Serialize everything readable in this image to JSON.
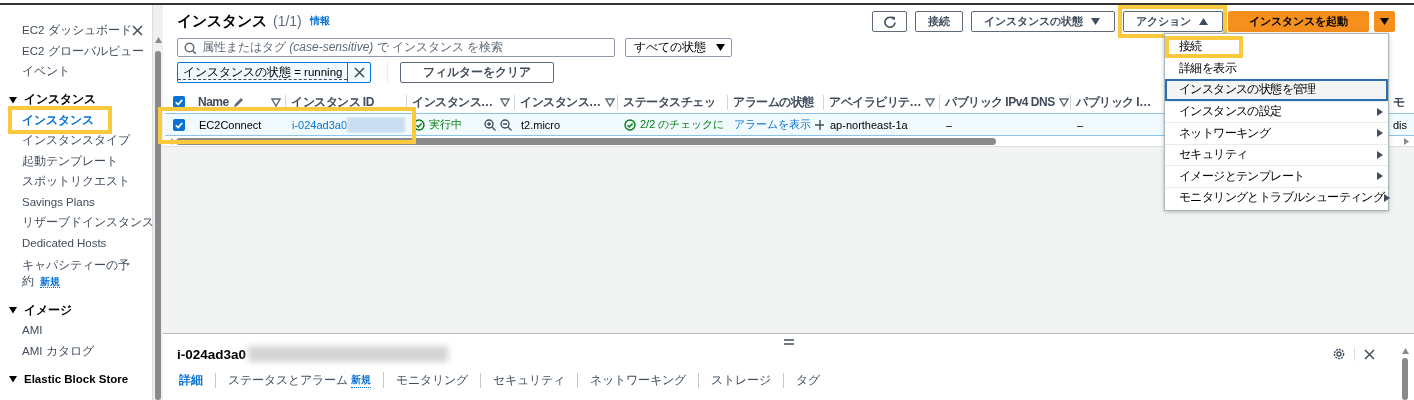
{
  "sidebar": {
    "items": [
      {
        "kind": "link",
        "label": "EC2 ダッシュボード",
        "selected": false,
        "highlighted": false
      },
      {
        "kind": "link",
        "label": "EC2 グローバルビュー",
        "selected": false,
        "highlighted": false
      },
      {
        "kind": "link",
        "label": "イベント",
        "selected": false,
        "highlighted": false
      },
      {
        "kind": "section",
        "label": "インスタンス",
        "expanded": true,
        "children": [
          {
            "label": "インスタンス",
            "selected": true,
            "highlighted": true
          },
          {
            "label": "インスタンスタイプ",
            "selected": false,
            "highlighted": false
          },
          {
            "label": "起動テンプレート",
            "selected": false,
            "highlighted": false
          },
          {
            "label": "スポットリクエスト",
            "selected": false,
            "highlighted": false
          },
          {
            "label": "Savings Plans",
            "selected": false,
            "highlighted": false
          },
          {
            "label": "リザーブドインスタンス",
            "selected": false,
            "highlighted": false
          },
          {
            "label": "Dedicated Hosts",
            "selected": false,
            "highlighted": false
          },
          {
            "label": "キャパシティーの予約",
            "badge": "新規",
            "selected": false,
            "highlighted": false
          }
        ]
      },
      {
        "kind": "section",
        "label": "イメージ",
        "expanded": true,
        "children": [
          {
            "label": "AMI",
            "selected": false,
            "highlighted": false
          },
          {
            "label": "AMI カタログ",
            "selected": false,
            "highlighted": false
          }
        ]
      },
      {
        "kind": "section",
        "label": "Elastic Block Store",
        "expanded": true
      }
    ]
  },
  "header": {
    "title": "インスタンス",
    "count": "(1/1)",
    "info": "情報"
  },
  "toolbar": [
    {
      "kind": "refresh"
    },
    {
      "kind": "button",
      "label": "接続"
    },
    {
      "kind": "dropdown",
      "label": "インスタンスの状態",
      "expanded": false,
      "highlighted": false
    },
    {
      "kind": "dropdown",
      "label": "アクション",
      "expanded": true,
      "highlighted": true
    },
    {
      "kind": "primary",
      "label": "インスタンスを起動"
    },
    {
      "kind": "split"
    }
  ],
  "search": {
    "placeholder": "属性またはタグ *(case-sensitive)* で インスタンス を検索"
  },
  "state_filter": {
    "label": "すべての状態"
  },
  "filter_tokens": [
    {
      "label": "インスタンスの状態 = running"
    }
  ],
  "clear_filters": "フィルターをクリア",
  "table": {
    "select_all": {
      "checked": true
    },
    "columns": [
      {
        "label": "Name",
        "editable": true,
        "sortable": true
      },
      {
        "label": "インスタンス ID",
        "editable": false,
        "sortable": false
      },
      {
        "label": "インスタンス…",
        "editable": false,
        "sortable": true
      },
      {
        "label": "インスタンス…",
        "editable": false,
        "sortable": true
      },
      {
        "label": "ステータスチェッ",
        "editable": false,
        "sortable": false
      },
      {
        "label": "アラームの状態",
        "editable": false,
        "sortable": false
      },
      {
        "label": "アベイラビリテ…",
        "editable": false,
        "sortable": true
      },
      {
        "label": "パブリック IPv4 DNS",
        "editable": false,
        "sortable": true
      },
      {
        "label": "パブリック I…",
        "editable": false,
        "sortable": false
      },
      {
        "label": "モ",
        "editable": false,
        "sortable": false
      }
    ],
    "rows": [
      {
        "selected": true,
        "highlighted": true,
        "cells": [
          {
            "kind": "text",
            "text": "EC2Connect"
          },
          {
            "kind": "id",
            "text": "i-024ad3a0",
            "redacted": true
          },
          {
            "kind": "state",
            "text": "実行中"
          },
          {
            "kind": "text",
            "text": "t2.micro"
          },
          {
            "kind": "status",
            "text": "2/2 のチェックに"
          },
          {
            "kind": "alarm",
            "text": "アラームを表示"
          },
          {
            "kind": "text",
            "text": "ap-northeast-1a"
          },
          {
            "kind": "text",
            "text": "–"
          },
          {
            "kind": "text",
            "text": "–"
          },
          {
            "kind": "text",
            "text": "dis"
          }
        ]
      }
    ]
  },
  "action_menu": {
    "items": [
      {
        "kind": "action",
        "label": "接続",
        "focused": false,
        "highlighted": true
      },
      {
        "kind": "action",
        "label": "詳細を表示",
        "focused": false,
        "highlighted": false
      },
      {
        "kind": "action",
        "label": "インスタンスの状態を管理",
        "focused": true,
        "highlighted": false
      },
      {
        "kind": "submenu",
        "label": "インスタンスの設定",
        "focused": false,
        "highlighted": false
      },
      {
        "kind": "submenu",
        "label": "ネットワーキング",
        "focused": false,
        "highlighted": false
      },
      {
        "kind": "submenu",
        "label": "セキュリティ",
        "focused": false,
        "highlighted": false
      },
      {
        "kind": "submenu",
        "label": "イメージとテンプレート",
        "focused": false,
        "highlighted": false
      },
      {
        "kind": "submenu",
        "label": "モニタリングとトラブルシューティング",
        "focused": false,
        "highlighted": false
      }
    ]
  },
  "detail": {
    "title": "i-024ad3a0",
    "redacted": true,
    "tabs": [
      {
        "label": "詳細",
        "selected": true
      },
      {
        "label": "ステータスとアラーム",
        "badge": "新規",
        "selected": false
      },
      {
        "label": "モニタリング",
        "selected": false
      },
      {
        "label": "セキュリティ",
        "selected": false
      },
      {
        "label": "ネットワーキング",
        "selected": false
      },
      {
        "label": "ストレージ",
        "selected": false
      },
      {
        "label": "タグ",
        "selected": false
      }
    ]
  }
}
